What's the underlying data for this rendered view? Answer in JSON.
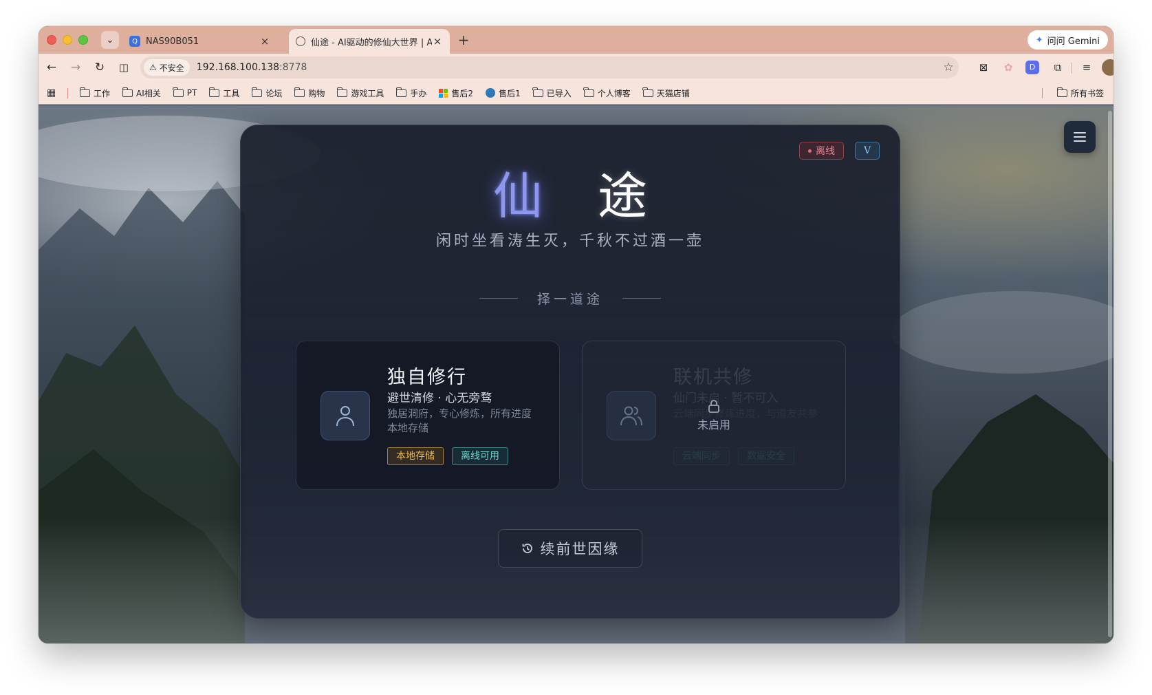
{
  "browser": {
    "tabs": [
      {
        "title": "NAS90B051",
        "close": "×"
      },
      {
        "title": "仙途 - AI驱动的修仙大世界 | AI",
        "close": "×"
      }
    ],
    "new_tab": "+",
    "gemini_label": "问问 Gemini",
    "address": {
      "security_label": "不安全",
      "url_host": "192.168.100.138",
      "url_port": ":8778"
    },
    "bookmarks": [
      {
        "label": "工作",
        "icon": "folder-icon"
      },
      {
        "label": "AI相关",
        "icon": "folder-icon"
      },
      {
        "label": "PT",
        "icon": "folder-icon"
      },
      {
        "label": "工具",
        "icon": "folder-icon"
      },
      {
        "label": "论坛",
        "icon": "folder-icon"
      },
      {
        "label": "购物",
        "icon": "folder-icon"
      },
      {
        "label": "游戏工具",
        "icon": "folder-icon"
      },
      {
        "label": "手办",
        "icon": "folder-icon"
      },
      {
        "label": "售后2",
        "icon": "windows-logo-icon"
      },
      {
        "label": "售后1",
        "icon": "site-icon"
      },
      {
        "label": "已导入",
        "icon": "folder-icon"
      },
      {
        "label": "个人博客",
        "icon": "folder-icon"
      },
      {
        "label": "天猫店铺",
        "icon": "folder-icon"
      }
    ],
    "all_bookmarks": "所有书签"
  },
  "app": {
    "status_badge": "离线",
    "version_badge": "V",
    "title_chars": [
      "仙",
      "途"
    ],
    "subtitle": "闲时坐看涛生灭，千秋不过酒一壶",
    "section_heading": "择一道途",
    "modes": {
      "solo": {
        "title": "独自修行",
        "subtitle": "避世清修 · 心无旁骛",
        "description": "独居洞府，专心修炼，所有进度本地存储",
        "tags": [
          "本地存储",
          "离线可用"
        ]
      },
      "online": {
        "title": "联机共修",
        "subtitle": "仙门未启 · 暂不可入",
        "description": "云端同步修炼进度，与道友共参",
        "tags": [
          "云端同步",
          "数据安全"
        ],
        "locked_label": "未启用"
      }
    },
    "resume_button": "续前世因缘"
  },
  "colors": {
    "accent": "#8e97ef",
    "offline_red": "#e88a92",
    "tag_gold": "#e8b94f",
    "tag_teal": "#6fd7c9",
    "tab_strip": "#dfaf9e",
    "toolbar": "#f6e4dd"
  }
}
